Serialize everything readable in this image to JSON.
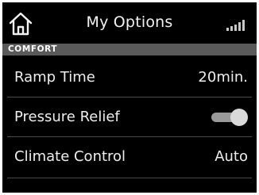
{
  "header": {
    "title": "My Options",
    "home_icon": "home-icon",
    "signal_icon": "signal-strength-icon"
  },
  "section": {
    "label": "COMFORT"
  },
  "rows": [
    {
      "label": "Ramp Time",
      "value": "20min."
    },
    {
      "label": "Pressure Relief",
      "toggle_on": true
    },
    {
      "label": "Climate Control",
      "value": "Auto"
    }
  ],
  "colors": {
    "background": "#000000",
    "section_bar": "#5a5a5a",
    "text": "#eeeeee",
    "toggle_track": "#9a9a9a",
    "toggle_knob": "#d9d9d9"
  }
}
